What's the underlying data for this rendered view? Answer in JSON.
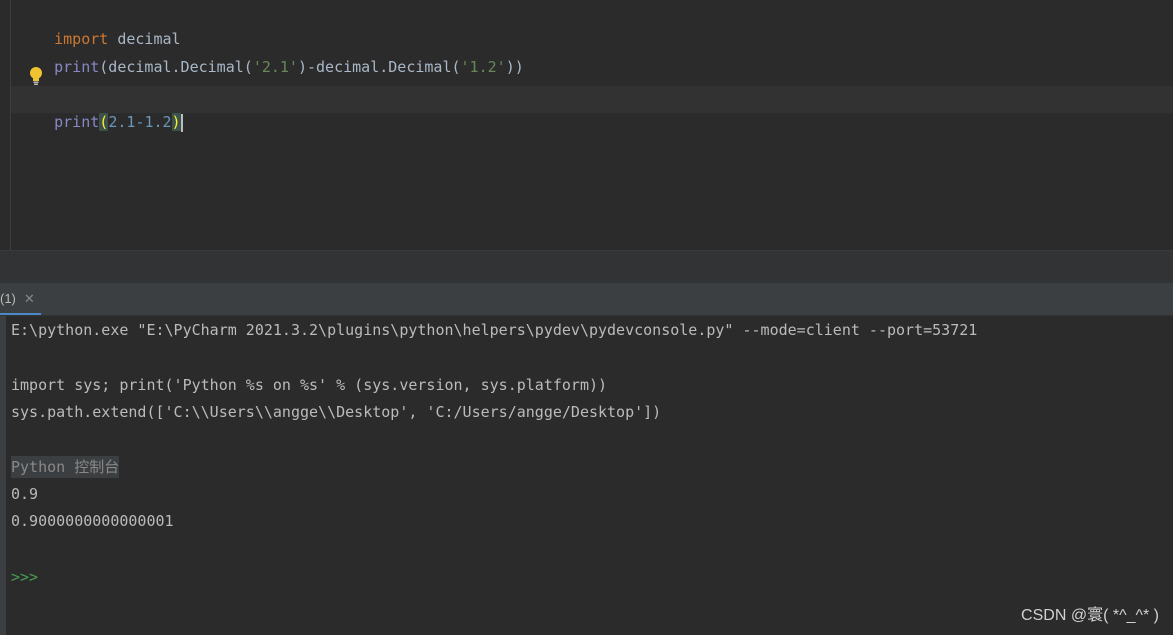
{
  "editor": {
    "line1": {
      "kw": "import",
      "rest": " decimal"
    },
    "line2": {
      "fn": "print",
      "p1": "(decimal.Decimal(",
      "s1": "'2.1'",
      "p2": ")-decimal.Decimal(",
      "s2": "'1.2'",
      "p3": "))"
    },
    "line3": {
      "fn": "print",
      "open": "(",
      "n1": "2.1",
      "minus": "-",
      "n2": "1.2",
      "close": ")"
    }
  },
  "tab": {
    "label": "(1)",
    "close": "✕"
  },
  "console": {
    "cmd": "E:\\python.exe \"E:\\PyCharm 2021.3.2\\plugins\\python\\helpers\\pydev\\pydevconsole.py\" --mode=client --port=53721",
    "import_line": "import sys; print('Python %s on %s' % (sys.version, sys.platform))",
    "path_line": "sys.path.extend(['C:\\\\Users\\\\angge\\\\Desktop', 'C:/Users/angge/Desktop'])",
    "console_label": "Python 控制台",
    "out1": "0.9",
    "out2": "0.9000000000000001",
    "prompt": ">>>"
  },
  "watermark": "CSDN @寰( *^_^* )",
  "colors": {
    "keyword": "#cc7832",
    "string": "#6a8759",
    "number": "#6897bb",
    "builtin": "#8888c6",
    "prompt": "#499c54"
  },
  "icons": {
    "bulb": "lightbulb-icon",
    "close": "close-icon"
  }
}
